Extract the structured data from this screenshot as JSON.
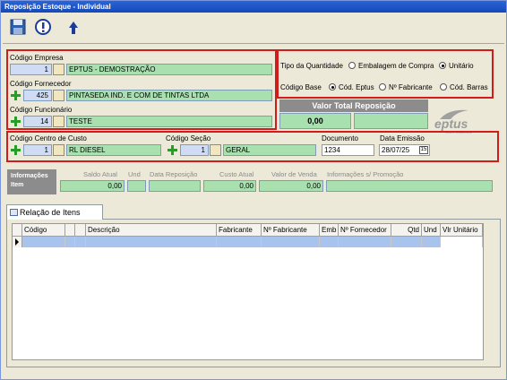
{
  "window": {
    "title": "Reposição Estoque - Individual"
  },
  "toolbar": {
    "icons": [
      "save-icon",
      "info-icon",
      "back-icon"
    ]
  },
  "empresa": {
    "label": "Código Empresa",
    "code": "1",
    "name": "EPTUS - DEMOSTRAÇÃO"
  },
  "fornecedor": {
    "label": "Código Fornecedor",
    "code": "425",
    "name": "PINTASEDA IND. E COM DE TINTAS LTDA"
  },
  "funcionario": {
    "label": "Código Funcionário",
    "code": "14",
    "name": "TESTE"
  },
  "tipo_quantidade": {
    "label": "Tipo da Quantidade",
    "options": [
      "Embalagem de Compra",
      "Unitário"
    ],
    "selected": "Unitário"
  },
  "codigo_base": {
    "label": "Código Base",
    "options": [
      "Cód. Eptus",
      "Nº Fabricante",
      "Cód. Barras"
    ],
    "selected": "Cód. Eptus"
  },
  "valor_total": {
    "label": "Valor Total Reposição",
    "value": "0,00"
  },
  "logo": {
    "text": "eptus",
    "sub": "CORPORATION"
  },
  "centro_custo": {
    "label": "Código Centro de Custo",
    "code": "1",
    "name": "RL DIESEL"
  },
  "secao": {
    "label": "Código Seção",
    "code": "1",
    "name": "GERAL"
  },
  "documento": {
    "label": "Documento",
    "value": "1234"
  },
  "data_emissao": {
    "label": "Data Emissão",
    "value": "28/07/25"
  },
  "informacoes": {
    "label_line1": "Informações",
    "label_line2": "Item",
    "columns": [
      "Saldo Atual",
      "Und",
      "Data Reposição",
      "Custo Atual",
      "Valor de Venda",
      "Informações s/ Promoção"
    ],
    "values": [
      "0,00",
      "",
      "",
      "0,00",
      "0,00",
      ""
    ]
  },
  "tab": {
    "label": "Relação de Itens"
  },
  "grid": {
    "columns": [
      "Código",
      "",
      "",
      "Descrição",
      "Fabricante",
      "Nº Fabricante",
      "Emb",
      "Nº Fornecedor",
      "Qtd",
      "Und",
      "Vlr Unitário"
    ]
  },
  "colors": {
    "highlight": "#d11c1c",
    "field_green": "#a8e0b0",
    "field_blue": "#cfdcf4",
    "titlebar": "#1548b8"
  }
}
